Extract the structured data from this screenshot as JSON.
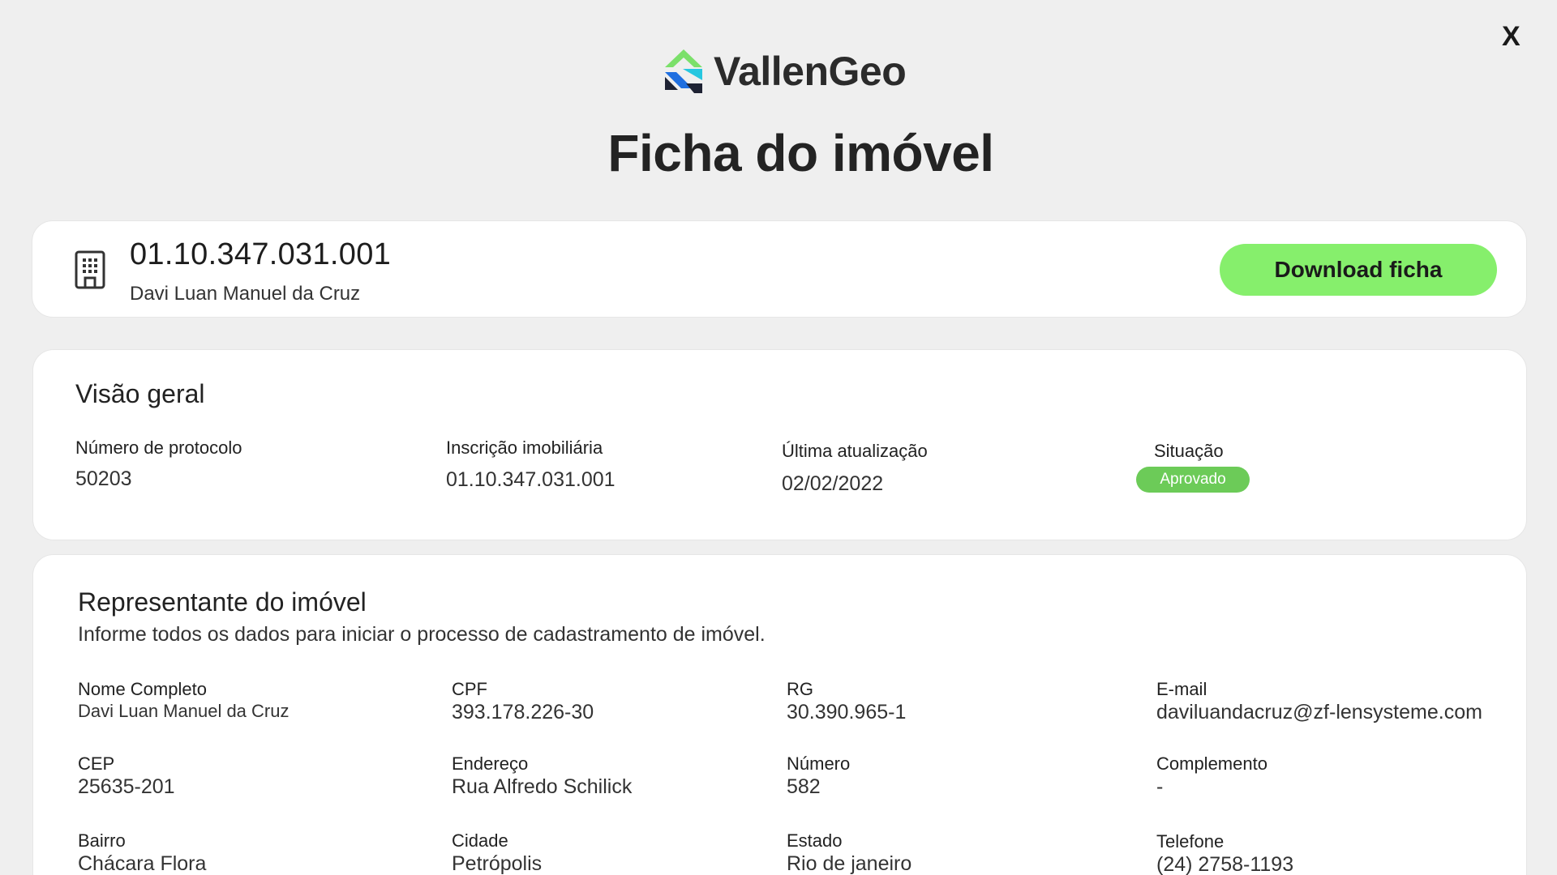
{
  "close_label": "X",
  "brand": {
    "name": "VallenGeo",
    "logo_colors": [
      "#7be06a",
      "#1f6fe0",
      "#27c7e0",
      "#1e2233"
    ]
  },
  "page_title": "Ficha do imóvel",
  "property": {
    "id": "01.10.347.031.001",
    "owner": "Davi Luan Manuel da Cruz",
    "download_label": "Download ficha"
  },
  "overview": {
    "title": "Visão geral",
    "fields": [
      {
        "label": "Número de protocolo",
        "value": "50203"
      },
      {
        "label": "Inscrição imobiliária",
        "value": "01.10.347.031.001"
      },
      {
        "label": "Última atualização",
        "value": "02/02/2022"
      },
      {
        "label": "Situação",
        "value": "Aprovado"
      }
    ]
  },
  "representative": {
    "title": "Representante do imóvel",
    "subtitle": "Informe todos os dados para iniciar o processo de cadastramento de imóvel.",
    "fields": [
      {
        "label": "Nome Completo",
        "value": "Davi Luan Manuel da Cruz"
      },
      {
        "label": "CPF",
        "value": "393.178.226-30"
      },
      {
        "label": "RG",
        "value": "30.390.965-1"
      },
      {
        "label": "E-mail",
        "value": "daviluandacruz@zf-lensysteme.com"
      },
      {
        "label": "CEP",
        "value": "25635-201"
      },
      {
        "label": "Endereço",
        "value": "Rua Alfredo Schilick"
      },
      {
        "label": "Número",
        "value": "582"
      },
      {
        "label": "Complemento",
        "value": "-"
      },
      {
        "label": "Bairro",
        "value": "Chácara Flora"
      },
      {
        "label": "Cidade",
        "value": "Petrópolis"
      },
      {
        "label": "Estado",
        "value": "Rio de janeiro"
      },
      {
        "label": "Telefone",
        "value": "(24) 2758-1193"
      }
    ]
  },
  "colors": {
    "accent": "#86ef6c",
    "status_approved": "#6ccb58",
    "background": "#efefef"
  }
}
